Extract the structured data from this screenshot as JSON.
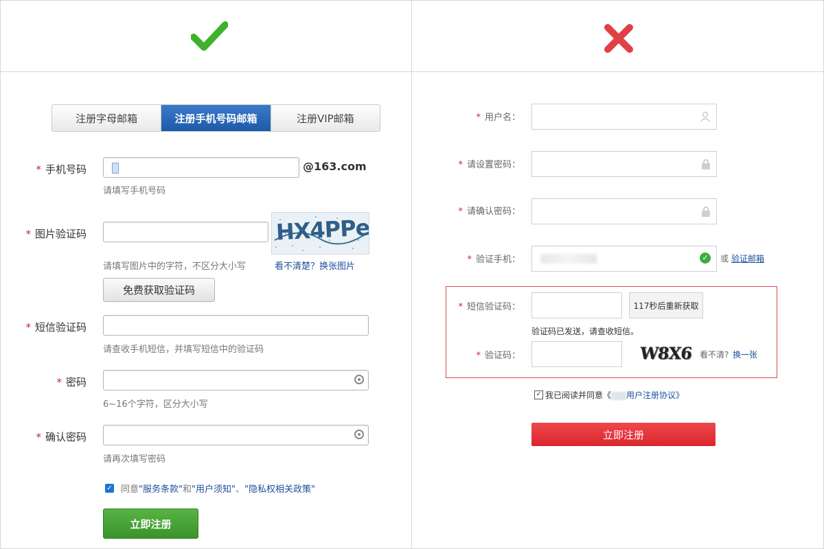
{
  "colors": {
    "good": "#3fb12a",
    "bad": "#e04146",
    "primary_blue": "#1d5aa8",
    "green_button": "#3a922b",
    "red_button": "#d9262d"
  },
  "left": {
    "tabs": [
      {
        "label": "注册字母邮箱",
        "active": false
      },
      {
        "label": "注册手机号码邮箱",
        "active": true
      },
      {
        "label": "注册VIP邮箱",
        "active": false
      }
    ],
    "phone": {
      "label": "手机号码",
      "domain": "@163.com",
      "hint": "请填写手机号码"
    },
    "captcha": {
      "label": "图片验证码",
      "image_text": "HX4PPe",
      "hint": "请填写图片中的字符，不区分大小写",
      "refresh_link": "看不清楚？换张图片"
    },
    "get_code_button": "免费获取验证码",
    "sms": {
      "label": "短信验证码",
      "hint": "请查收手机短信，并填写短信中的验证码"
    },
    "password": {
      "label": "密码",
      "hint": "6~16个字符，区分大小写"
    },
    "confirm": {
      "label": "确认密码",
      "hint": "请再次填写密码"
    },
    "agree": {
      "prefix": "同意",
      "terms": "\"服务条款\"",
      "and": "和",
      "notice": "\"用户须知\"",
      "sep": "、",
      "privacy": "\"隐私权相关政策\"",
      "checked": true
    },
    "submit": "立即注册"
  },
  "right": {
    "username": {
      "label": "用户名："
    },
    "password": {
      "label": "请设置密码："
    },
    "confirm": {
      "label": "请确认密码："
    },
    "phone": {
      "label": "验证手机：",
      "or": "或",
      "email_link": "验证邮箱"
    },
    "sms": {
      "label": "短信验证码：",
      "resend": "117秒后重新获取",
      "sent_note": "验证码已发送，请查收短信。"
    },
    "captcha": {
      "label": "验证码：",
      "image_text": "W8X6",
      "unclear": "看不清?",
      "change_link": "换一张"
    },
    "agree": {
      "text": "我已阅读并同意《",
      "link": "用户注册协议》",
      "checked": true
    },
    "submit": "立即注册"
  }
}
